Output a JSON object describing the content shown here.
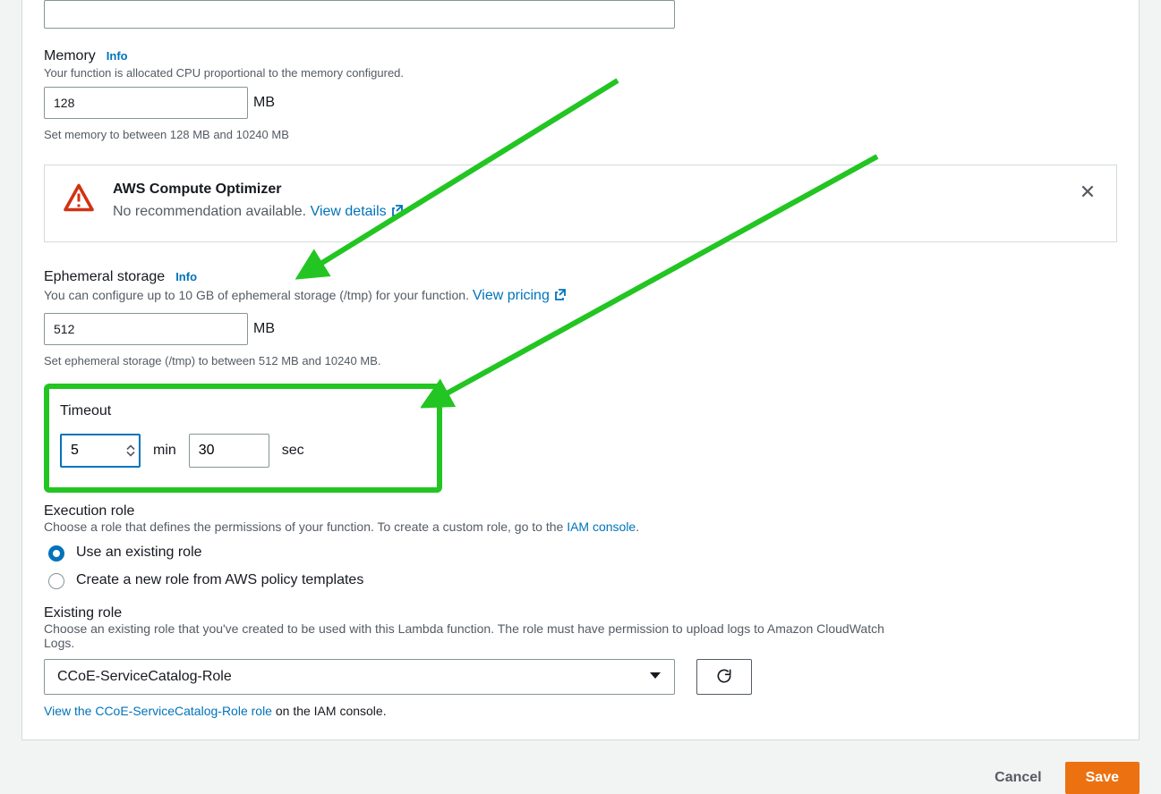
{
  "memory": {
    "title": "Memory",
    "info": "Info",
    "desc": "Your function is allocated CPU proportional to the memory configured.",
    "value": "128",
    "unit": "MB",
    "hint": "Set memory to between 128 MB and 10240 MB"
  },
  "optimizer": {
    "title": "AWS Compute Optimizer",
    "text": "No recommendation available. ",
    "link": "View details"
  },
  "ephemeral": {
    "title": "Ephemeral storage",
    "info": "Info",
    "desc": "You can configure up to 10 GB of ephemeral storage (/tmp) for your function. ",
    "pricing": "View pricing",
    "value": "512",
    "unit": "MB",
    "hint": "Set ephemeral storage (/tmp) to between 512 MB and 10240 MB."
  },
  "timeout": {
    "title": "Timeout",
    "min_value": "5",
    "min_label": "min",
    "sec_value": "30",
    "sec_label": "sec"
  },
  "exec_role": {
    "title": "Execution role",
    "desc_prefix": "Choose a role that defines the permissions of your function. To create a custom role, go to the ",
    "iam_link": "IAM console",
    "desc_suffix": ".",
    "opt_existing": "Use an existing role",
    "opt_new": "Create a new role from AWS policy templates"
  },
  "existing_role": {
    "title": "Existing role",
    "desc": "Choose an existing role that you've created to be used with this Lambda function. The role must have permission to upload logs to Amazon CloudWatch Logs.",
    "selected": "CCoE-ServiceCatalog-Role",
    "view_link": "View the CCoE-ServiceCatalog-Role role",
    "view_suffix": " on the IAM console."
  },
  "actions": {
    "cancel": "Cancel",
    "save": "Save"
  }
}
